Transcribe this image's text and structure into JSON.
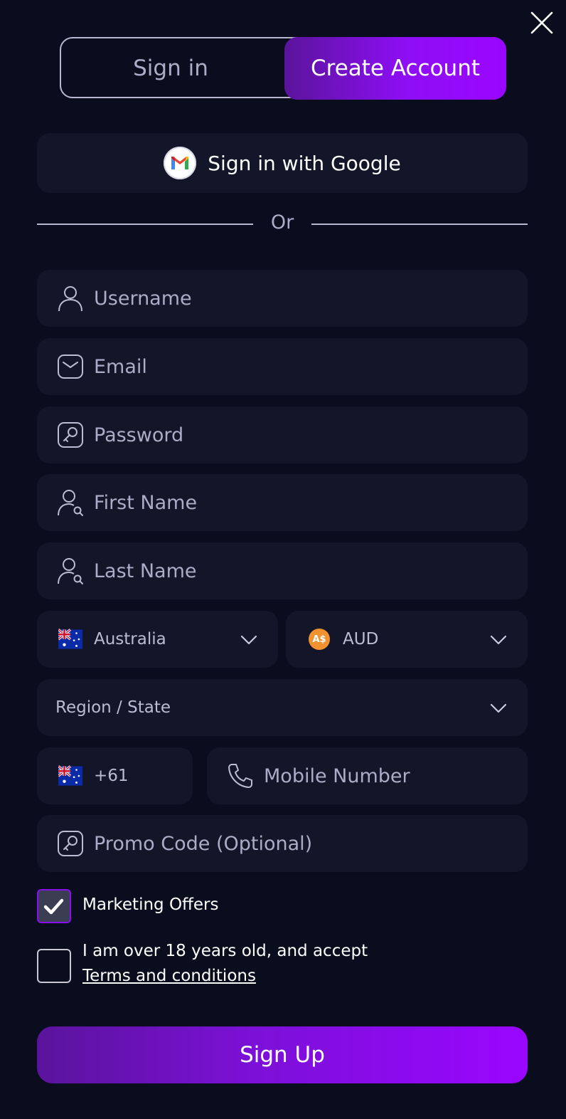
{
  "tabs": {
    "signin_label": "Sign in",
    "create_label": "Create Account"
  },
  "google": {
    "label": "Sign in with Google"
  },
  "divider": {
    "text": "Or"
  },
  "fields": {
    "username_placeholder": "Username",
    "email_placeholder": "Email",
    "password_placeholder": "Password",
    "first_name_placeholder": "First Name",
    "last_name_placeholder": "Last Name",
    "country_value": "Australia",
    "currency_value": "AUD",
    "currency_badge": "A$",
    "region_placeholder": "Region / State",
    "phone_code": "+61",
    "mobile_placeholder": "Mobile Number",
    "promo_placeholder": "Promo Code (Optional)"
  },
  "checkboxes": {
    "marketing_label": "Marketing Offers",
    "marketing_checked": true,
    "age_label": "I am over 18 years old, and accept",
    "age_checked": false,
    "terms_link": "Terms and conditions"
  },
  "submit": {
    "label": "Sign Up"
  },
  "colors": {
    "accent": "#9a06ff",
    "accent_dark": "#5a149c",
    "background": "#0a0d1e",
    "field_bg": "#131628",
    "muted_text": "#a9adc7"
  },
  "icons": [
    "close-icon",
    "gmail-icon",
    "user-icon",
    "mail-icon",
    "key-icon",
    "user-search-icon",
    "flag-au-icon",
    "currency-aud-icon",
    "chevron-down-icon",
    "phone-icon",
    "check-icon"
  ]
}
